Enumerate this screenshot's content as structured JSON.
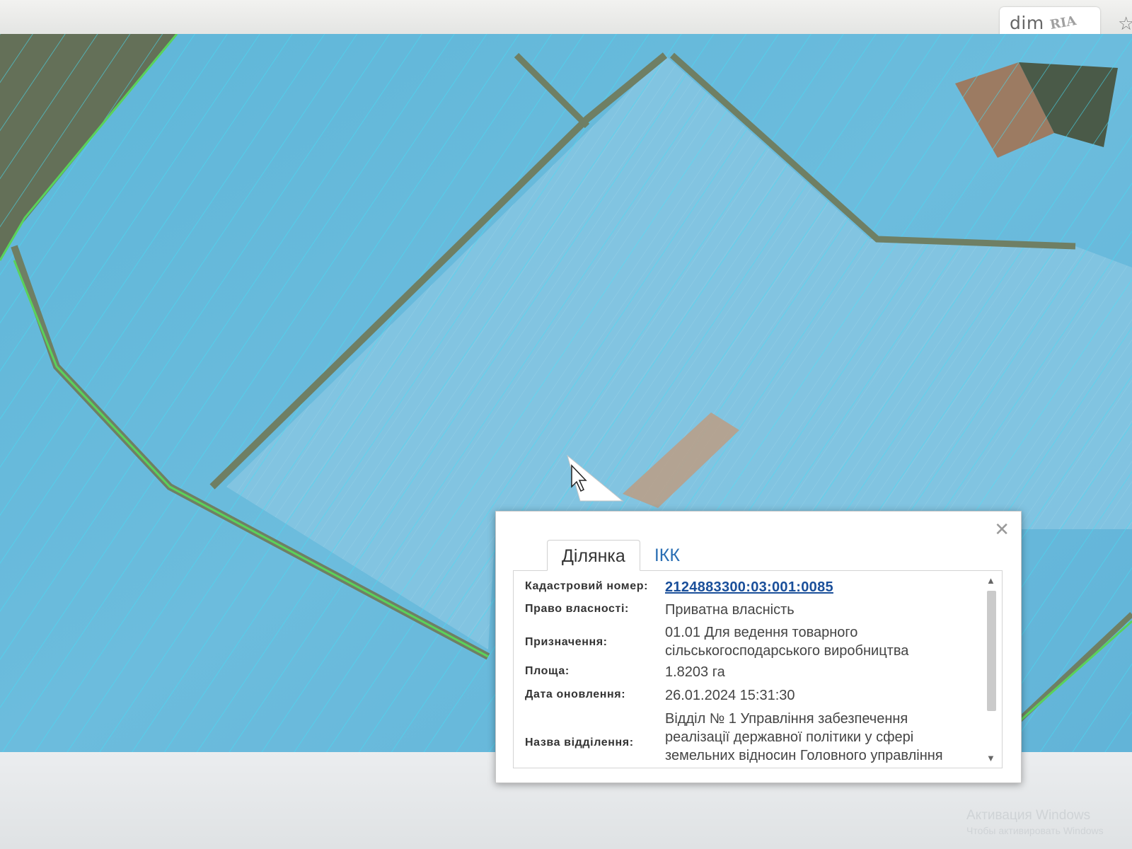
{
  "watermark": {
    "brand_dim": "dim",
    "brand_ria": "RIA"
  },
  "icons": {
    "bookmark": "star-icon",
    "close": "close-icon",
    "cursor": "cursor-arrow-icon"
  },
  "colors": {
    "parcel_fill": "#5fb7dc",
    "parcel_line": "#4fe0f5",
    "link": "#1a4f9a"
  },
  "popup": {
    "tabs": [
      {
        "label": "Ділянка"
      },
      {
        "label": "ІКК"
      }
    ],
    "fields": [
      {
        "label": "Кадастровий номер:",
        "value": "2124883300:03:001:0085"
      },
      {
        "label": "Право власності:",
        "value": "Приватна власність"
      },
      {
        "label": "Призначення:",
        "value_lines": [
          "01.01 Для ведення товарного",
          "сільськогосподарського виробництва"
        ]
      },
      {
        "label": "Площа:",
        "value": "1.8203 га"
      },
      {
        "label": "Дата оновлення:",
        "value": "26.01.2024 15:31:30"
      },
      {
        "label": "Назва відділення:",
        "value_lines": [
          "Відділ № 1 Управління забезпечення",
          "реалізації державної політики у сфері",
          "земельних відносин Головного управління"
        ]
      }
    ]
  },
  "os": {
    "activation_title": "Активация Windows",
    "activation_sub": "Чтобы активировать Windows"
  }
}
